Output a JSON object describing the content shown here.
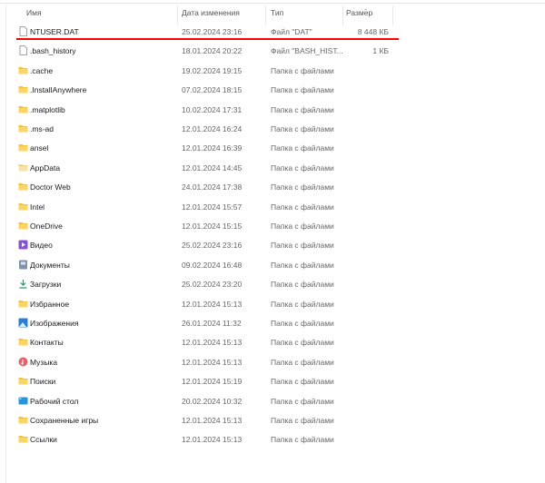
{
  "columns": {
    "name": "Имя",
    "date": "Дата изменения",
    "type": "Тип",
    "size": "Размер"
  },
  "highlight_color": "#ff0000",
  "rows": [
    {
      "name": "NTUSER.DAT",
      "date": "25.02.2024 23:16",
      "type": "Файл \"DAT\"",
      "size": "8 448 КБ",
      "icon": "file"
    },
    {
      "name": ".bash_history",
      "date": "18.01.2024 20:22",
      "type": "Файл \"BASH_HIST...",
      "size": "1 КБ",
      "icon": "file"
    },
    {
      "name": ".cache",
      "date": "19.02.2024 19:15",
      "type": "Папка с файлами",
      "size": "",
      "icon": "folder"
    },
    {
      "name": ".InstallAnywhere",
      "date": "07.02.2024 18:15",
      "type": "Папка с файлами",
      "size": "",
      "icon": "folder"
    },
    {
      "name": ".matplotlib",
      "date": "10.02.2024 17:31",
      "type": "Папка с файлами",
      "size": "",
      "icon": "folder"
    },
    {
      "name": ".ms-ad",
      "date": "12.01.2024 16:24",
      "type": "Папка с файлами",
      "size": "",
      "icon": "folder"
    },
    {
      "name": "ansel",
      "date": "12.01.2024 16:39",
      "type": "Папка с файлами",
      "size": "",
      "icon": "folder"
    },
    {
      "name": "AppData",
      "date": "12.01.2024 14:45",
      "type": "Папка с файлами",
      "size": "",
      "icon": "folder-light"
    },
    {
      "name": "Doctor Web",
      "date": "24.01.2024 17:38",
      "type": "Папка с файлами",
      "size": "",
      "icon": "folder"
    },
    {
      "name": "Intel",
      "date": "12.01.2024 15:57",
      "type": "Папка с файлами",
      "size": "",
      "icon": "folder"
    },
    {
      "name": "OneDrive",
      "date": "12.01.2024 15:15",
      "type": "Папка с файлами",
      "size": "",
      "icon": "folder"
    },
    {
      "name": "Видео",
      "date": "25.02.2024 23:16",
      "type": "Папка с файлами",
      "size": "",
      "icon": "video"
    },
    {
      "name": "Документы",
      "date": "09.02.2024 16:48",
      "type": "Папка с файлами",
      "size": "",
      "icon": "documents"
    },
    {
      "name": "Загрузки",
      "date": "25.02.2024 23:20",
      "type": "Папка с файлами",
      "size": "",
      "icon": "download"
    },
    {
      "name": "Избранное",
      "date": "12.01.2024 15:13",
      "type": "Папка с файлами",
      "size": "",
      "icon": "folder"
    },
    {
      "name": "Изображения",
      "date": "26.01.2024 11:32",
      "type": "Папка с файлами",
      "size": "",
      "icon": "pictures"
    },
    {
      "name": "Контакты",
      "date": "12.01.2024 15:13",
      "type": "Папка с файлами",
      "size": "",
      "icon": "folder"
    },
    {
      "name": "Музыка",
      "date": "12.01.2024 15:13",
      "type": "Папка с файлами",
      "size": "",
      "icon": "music"
    },
    {
      "name": "Поиски",
      "date": "12.01.2024 15:19",
      "type": "Папка с файлами",
      "size": "",
      "icon": "folder"
    },
    {
      "name": "Рабочий стол",
      "date": "20.02.2024 10:32",
      "type": "Папка с файлами",
      "size": "",
      "icon": "desktop"
    },
    {
      "name": "Сохраненные игры",
      "date": "12.01.2024 15:13",
      "type": "Папка с файлами",
      "size": "",
      "icon": "folder"
    },
    {
      "name": "Ссылки",
      "date": "12.01.2024 15:13",
      "type": "Папка с файлами",
      "size": "",
      "icon": "folder"
    }
  ]
}
